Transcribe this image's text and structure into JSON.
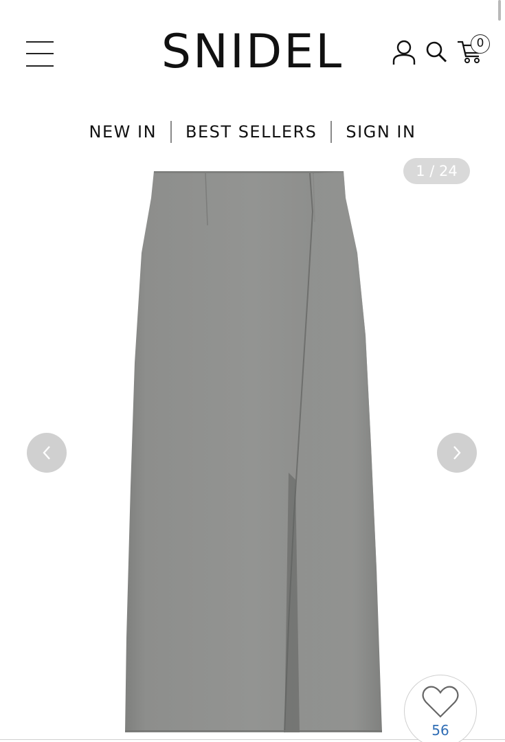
{
  "brand": {
    "logo_text": "SNIDEL"
  },
  "header": {
    "menu_icon": "hamburger-icon",
    "account_icon": "account-icon",
    "search_icon": "search-icon",
    "cart_icon": "cart-icon",
    "cart_count": "0"
  },
  "nav": {
    "items": [
      {
        "label": "NEW IN"
      },
      {
        "label": "BEST SELLERS"
      },
      {
        "label": "SIGN IN"
      }
    ]
  },
  "gallery": {
    "counter": "1 / 24",
    "prev_icon": "chevron-left-icon",
    "next_icon": "chevron-right-icon",
    "product_color": "#8e8f8d"
  },
  "favorite": {
    "icon": "heart-icon",
    "count": "56",
    "count_color": "#2f6db5"
  }
}
